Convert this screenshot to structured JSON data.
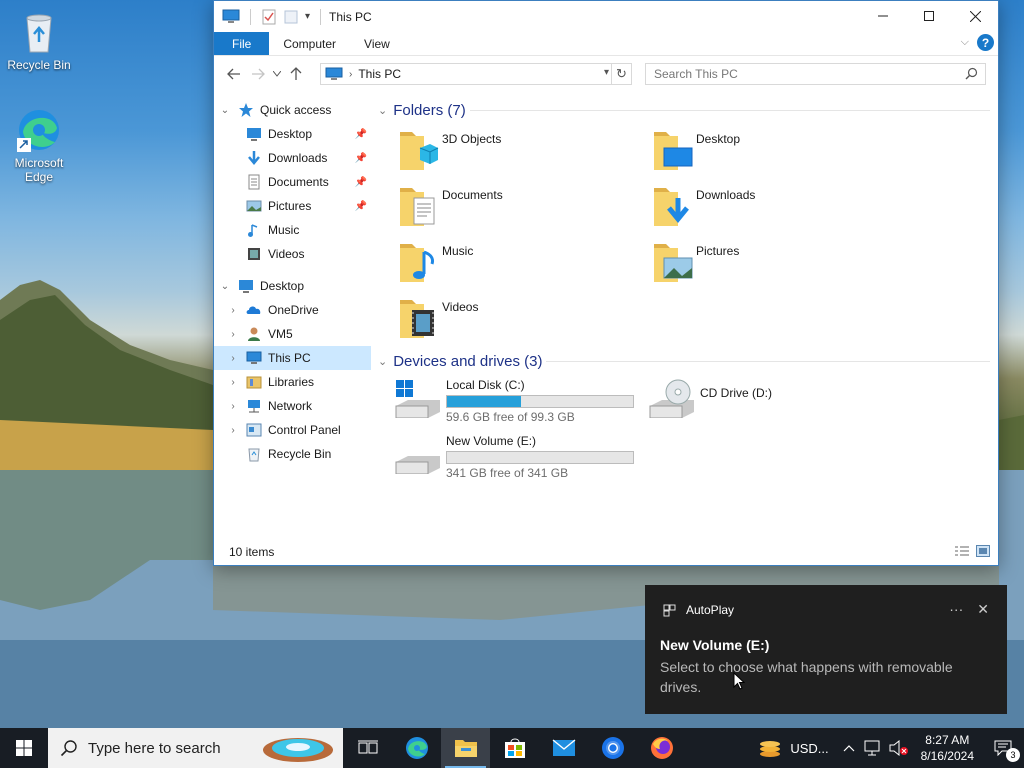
{
  "desktop": {
    "icons": [
      {
        "label": "Recycle Bin",
        "icon": "recycle-bin-icon"
      },
      {
        "label": "Microsoft Edge",
        "icon": "edge-icon"
      }
    ]
  },
  "window": {
    "title": "This PC",
    "ribbon_tabs": [
      "File",
      "Computer",
      "View"
    ],
    "help": "?",
    "address": {
      "location": "This PC"
    },
    "search": {
      "placeholder": "Search This PC"
    },
    "status": "10 items"
  },
  "nav": {
    "items": [
      {
        "label": "Quick access",
        "icon": "star-icon",
        "expanded": true
      },
      {
        "label": "Desktop",
        "icon": "desktop-icon",
        "pinned": true
      },
      {
        "label": "Downloads",
        "icon": "downloads-icon",
        "pinned": true
      },
      {
        "label": "Documents",
        "icon": "documents-icon",
        "pinned": true
      },
      {
        "label": "Pictures",
        "icon": "pictures-icon",
        "pinned": true
      },
      {
        "label": "Music",
        "icon": "music-icon"
      },
      {
        "label": "Videos",
        "icon": "videos-icon"
      },
      {
        "label": "Desktop",
        "icon": "desktop-icon",
        "expanded": true
      },
      {
        "label": "OneDrive",
        "icon": "onedrive-icon"
      },
      {
        "label": "VM5",
        "icon": "user-icon"
      },
      {
        "label": "This PC",
        "icon": "this-pc-icon",
        "selected": true
      },
      {
        "label": "Libraries",
        "icon": "libraries-icon"
      },
      {
        "label": "Network",
        "icon": "network-icon"
      },
      {
        "label": "Control Panel",
        "icon": "control-panel-icon"
      },
      {
        "label": "Recycle Bin",
        "icon": "recycle-bin-icon"
      }
    ]
  },
  "content": {
    "folders_header": "Folders (7)",
    "folders": [
      {
        "label": "3D Objects",
        "icon": "3d-objects-folder-icon"
      },
      {
        "label": "Desktop",
        "icon": "desktop-folder-icon"
      },
      {
        "label": "Documents",
        "icon": "documents-folder-icon"
      },
      {
        "label": "Downloads",
        "icon": "downloads-folder-icon"
      },
      {
        "label": "Music",
        "icon": "music-folder-icon"
      },
      {
        "label": "Pictures",
        "icon": "pictures-folder-icon"
      },
      {
        "label": "Videos",
        "icon": "videos-folder-icon"
      }
    ],
    "drives_header": "Devices and drives (3)",
    "drives": [
      {
        "label": "Local Disk (C:)",
        "free": "59.6 GB free of 99.3 GB",
        "used_fraction": 0.4,
        "icon": "windows-drive-icon"
      },
      {
        "label": "CD Drive (D:)",
        "icon": "cd-drive-icon"
      },
      {
        "label": "New Volume (E:)",
        "free": "341 GB free of 341 GB",
        "used_fraction": 0.0,
        "icon": "removable-drive-icon"
      }
    ]
  },
  "toast": {
    "app": "AutoPlay",
    "title": "New Volume (E:)",
    "body": "Select to choose what happens with removable drives."
  },
  "taskbar": {
    "search_placeholder": "Type here to search",
    "apps": [
      "task-view-icon",
      "edge-icon",
      "file-explorer-icon",
      "store-icon",
      "mail-icon",
      "chrome-icon",
      "firefox-icon"
    ],
    "weather": "USD...",
    "time": "8:27 AM",
    "date": "8/16/2024",
    "notifications": "3"
  },
  "colors": {
    "accent": "#1979ca",
    "selection": "#cce8ff",
    "group_header": "#1e3287",
    "drive_bar": "#26a0da",
    "taskbar": "#181d24",
    "toast": "#1f1f1f"
  }
}
